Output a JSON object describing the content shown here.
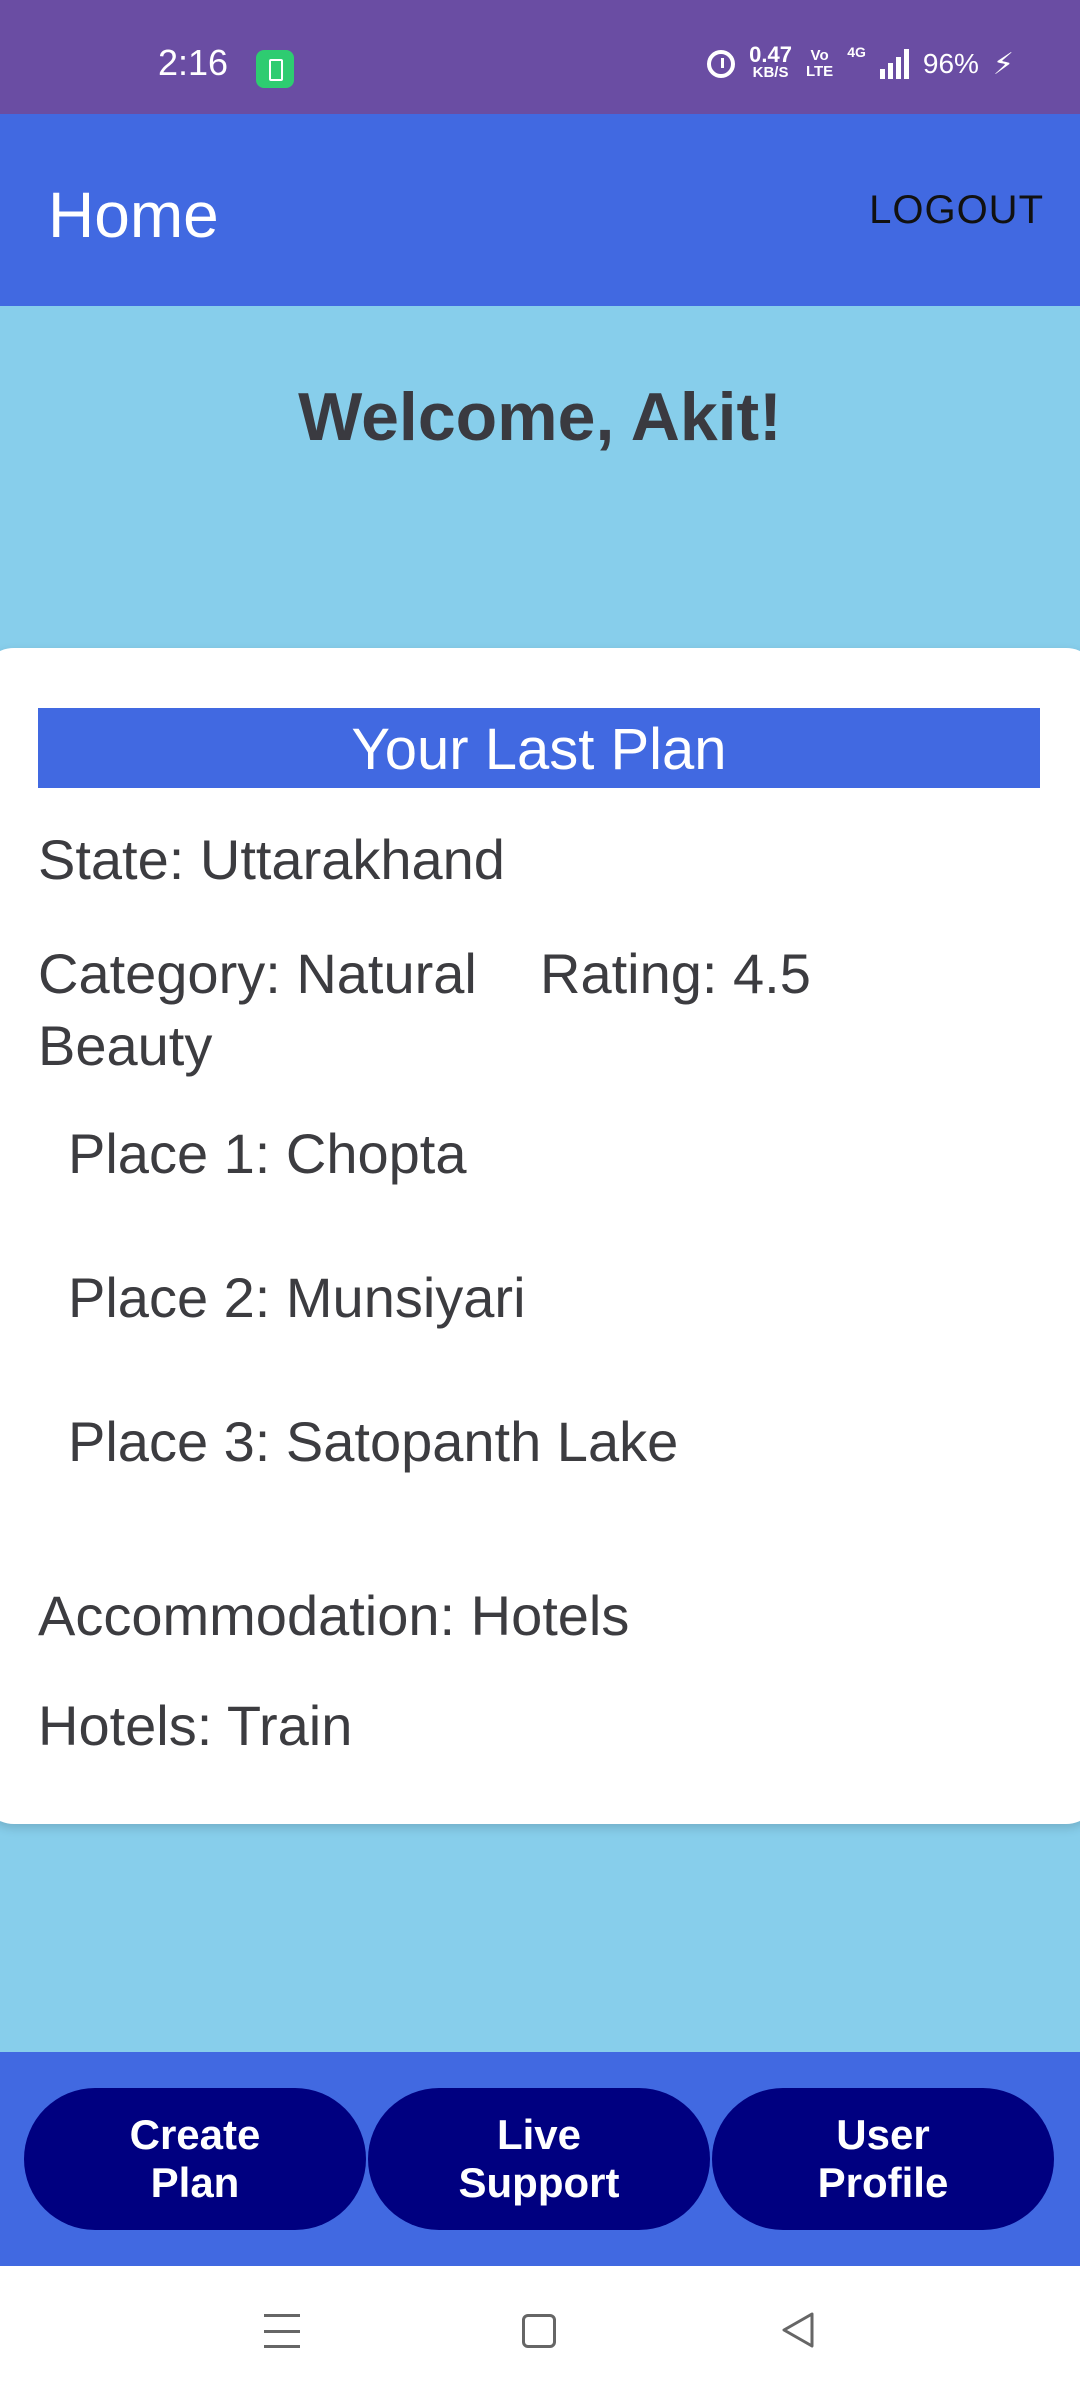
{
  "status_bar": {
    "time": "2:16",
    "net_speed_value": "0.47",
    "net_speed_unit": "KB/S",
    "volte_top": "Vo",
    "volte_bottom": "LTE",
    "network_type": "4G",
    "battery": "96%",
    "icons": [
      "alarm-icon",
      "signal-icon",
      "charging-bolt-icon"
    ]
  },
  "app_bar": {
    "title": "Home",
    "logout_label": "LOGOUT"
  },
  "welcome_text": "Welcome, Akit!",
  "plan_card": {
    "header": "Your Last Plan",
    "state": "State: Uttarakhand",
    "category": "Category: Natural Beauty",
    "rating": "Rating: 4.5",
    "places": [
      "Place 1: Chopta",
      "Place 2: Munsiyari",
      "Place 3: Satopanth Lake"
    ],
    "accommodation": "Accommodation: Hotels",
    "hotels": "Hotels: Train"
  },
  "bottom_bar": {
    "create_plan": [
      "Create",
      "Plan"
    ],
    "live_support": [
      "Live",
      "Support"
    ],
    "user_profile": [
      "User",
      "Profile"
    ]
  },
  "colors": {
    "status_bar": "#6A4DA3",
    "app_bar": "#4169E1",
    "background": "#87CEEB",
    "button": "#000080"
  }
}
